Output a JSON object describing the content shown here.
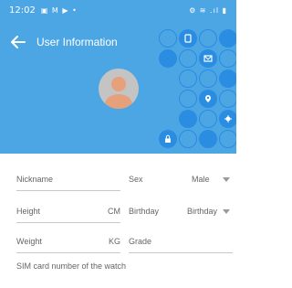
{
  "status_bar": {
    "time": "12:02",
    "notification_icons": "▣ M ▶ •",
    "system_icons": "⚙ ≋ .ıl ▮"
  },
  "app_bar": {
    "title": "User Information",
    "back_icon": "arrow-left-icon"
  },
  "colors": {
    "header_bg": "#4da6e4",
    "circle_fill": "#2a8de2",
    "avatar_bg": "#c4c4c4",
    "avatar_person": "#e6a07a"
  },
  "form": {
    "nickname": {
      "label": "Nickname"
    },
    "sex": {
      "label": "Sex",
      "value": "Male"
    },
    "height": {
      "label": "Height",
      "unit": "CM"
    },
    "birthday": {
      "label": "Birthday",
      "value": "Birthday"
    },
    "weight": {
      "label": "Weight",
      "unit": "KG"
    },
    "grade": {
      "label": "Grade"
    },
    "sim": {
      "label": "SIM card number of the watch"
    }
  }
}
